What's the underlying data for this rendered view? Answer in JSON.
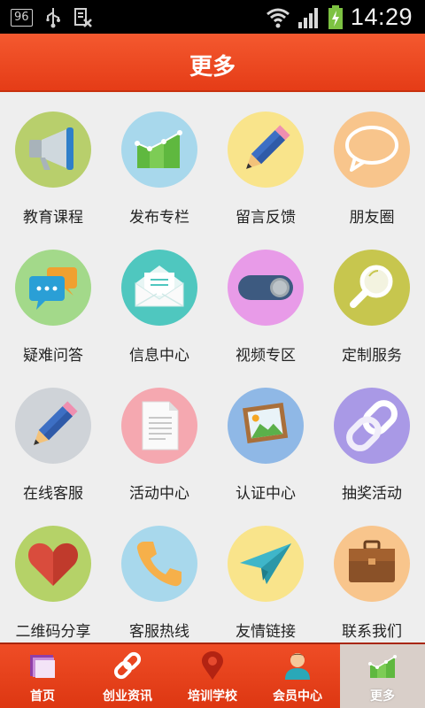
{
  "status_bar": {
    "badge": "96",
    "time": "14:29"
  },
  "header": {
    "title": "更多"
  },
  "grid_items": [
    {
      "label": "教育课程",
      "icon": "megaphone-icon",
      "bg": "#b8cf6c"
    },
    {
      "label": "发布专栏",
      "icon": "bar-chart-icon",
      "bg": "#a8d8ec"
    },
    {
      "label": "留言反馈",
      "icon": "pencil-icon",
      "bg": "#f9e48b"
    },
    {
      "label": "朋友圈",
      "icon": "speech-bubble-icon",
      "bg": "#f8c58c"
    },
    {
      "label": "疑难问答",
      "icon": "chat-bubbles-icon",
      "bg": "#a3d98a"
    },
    {
      "label": "信息中心",
      "icon": "envelope-icon",
      "bg": "#4fc7bf"
    },
    {
      "label": "视频专区",
      "icon": "toggle-icon",
      "bg": "#e89be8"
    },
    {
      "label": "定制服务",
      "icon": "magnifier-icon",
      "bg": "#c7c64e"
    },
    {
      "label": "在线客服",
      "icon": "pencil-icon",
      "bg": "#cfd3d8"
    },
    {
      "label": "活动中心",
      "icon": "document-icon",
      "bg": "#f5a8b0"
    },
    {
      "label": "认证中心",
      "icon": "picture-icon",
      "bg": "#8fb8e6"
    },
    {
      "label": "抽奖活动",
      "icon": "chain-link-icon",
      "bg": "#a999e6"
    },
    {
      "label": "二维码分享",
      "icon": "heart-icon",
      "bg": "#b5d268"
    },
    {
      "label": "客服热线",
      "icon": "phone-icon",
      "bg": "#a8d8ec"
    },
    {
      "label": "友情链接",
      "icon": "paper-plane-icon",
      "bg": "#f9e48b"
    },
    {
      "label": "联系我们",
      "icon": "briefcase-icon",
      "bg": "#f8c58c"
    }
  ],
  "tabs": [
    {
      "label": "首页",
      "icon": "folder-icon"
    },
    {
      "label": "创业资讯",
      "icon": "chain-link-icon"
    },
    {
      "label": "培训学校",
      "icon": "map-pin-icon"
    },
    {
      "label": "会员中心",
      "icon": "user-avatar-icon"
    },
    {
      "label": "更多",
      "icon": "bar-chart-icon",
      "active": true
    }
  ]
}
